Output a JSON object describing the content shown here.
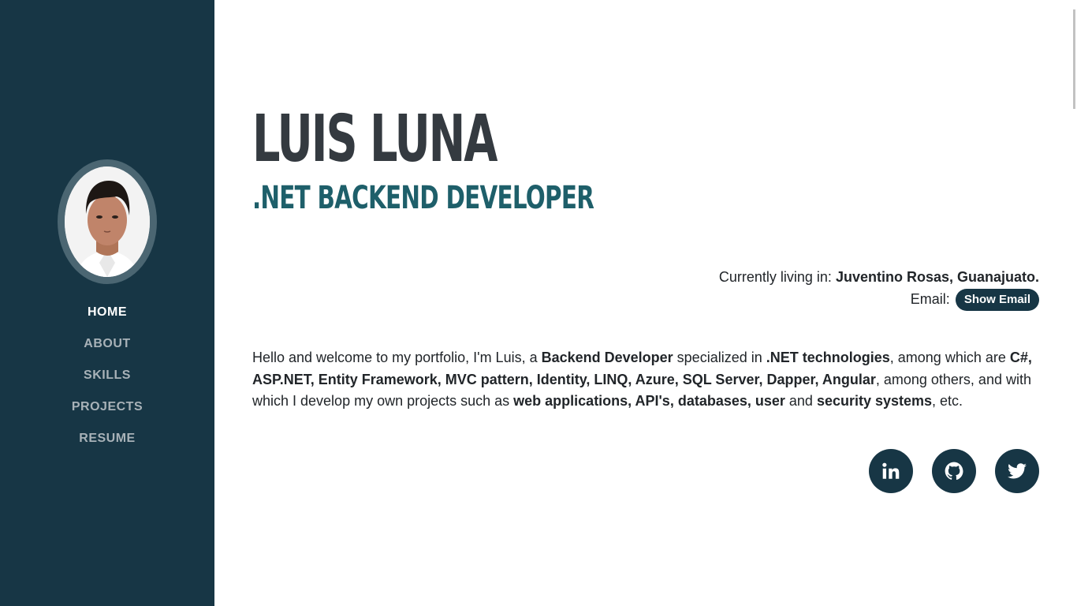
{
  "sidebar": {
    "nav": [
      {
        "label": "HOME",
        "active": true
      },
      {
        "label": "ABOUT",
        "active": false
      },
      {
        "label": "SKILLS",
        "active": false
      },
      {
        "label": "PROJECTS",
        "active": false
      },
      {
        "label": "RESUME",
        "active": false
      }
    ]
  },
  "header": {
    "name": "LUIS LUNA",
    "role": ".NET BACKEND DEVELOPER"
  },
  "info": {
    "living_label": "Currently living in:",
    "location": "Juventino Rosas, Guanajuato.",
    "email_label": "Email:",
    "email_button": "Show Email"
  },
  "bio": {
    "parts": [
      {
        "text": "Hello and welcome to my portfolio, I'm Luis, a ",
        "bold": false
      },
      {
        "text": "Backend Developer",
        "bold": true
      },
      {
        "text": " specialized in ",
        "bold": false
      },
      {
        "text": ".NET technologies",
        "bold": true
      },
      {
        "text": ", among which are ",
        "bold": false
      },
      {
        "text": "C#, ASP.NET, Entity Framework, MVC pattern, Identity, LINQ, Azure, SQL Server, Dapper, Angular",
        "bold": true
      },
      {
        "text": ", among others, and with which I develop my own projects such as ",
        "bold": false
      },
      {
        "text": "web applications, API's, databases, user",
        "bold": true
      },
      {
        "text": " and ",
        "bold": false
      },
      {
        "text": "security systems",
        "bold": true
      },
      {
        "text": ", etc.",
        "bold": false
      }
    ]
  },
  "socials": [
    {
      "icon": "linkedin-icon"
    },
    {
      "icon": "github-icon"
    },
    {
      "icon": "twitter-icon"
    }
  ],
  "colors": {
    "sidebar_bg": "#173645",
    "accent": "#1e5f6a",
    "name_text": "#343a40"
  }
}
